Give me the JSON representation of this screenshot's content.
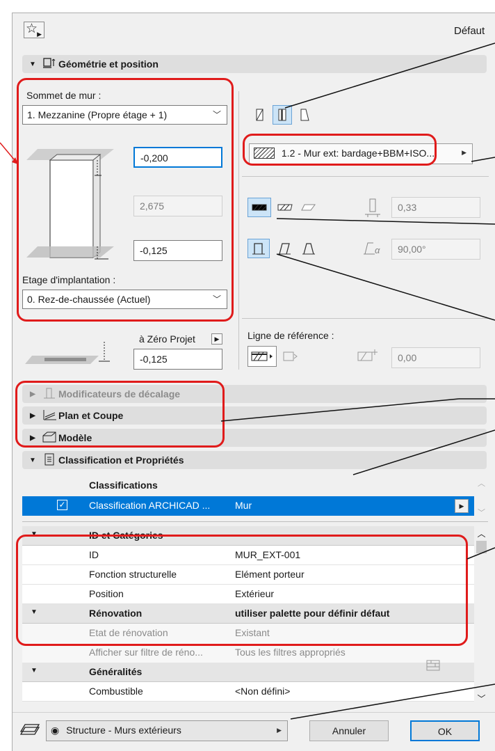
{
  "header": {
    "favorites_glyph": "☆",
    "default_label": "Défaut"
  },
  "geometry": {
    "section_title": "Géométrie et position",
    "top_label": "Sommet de mur :",
    "top_value": "1. Mezzanine (Propre étage + 1)",
    "top_offset": "-0,200",
    "height": "2,675",
    "base_offset": "-0,125",
    "home_story_label": "Etage d'implantation :",
    "home_story_value": "0. Rez-de-chaussée (Actuel)",
    "project_zero_label": "à Zéro Projet",
    "project_zero_value": "-0,125",
    "composite_name": "1.2 - Mur ext: bardage+BBM+ISO...",
    "thickness": "0,33",
    "angle": "90,00°",
    "angle_symbol": "α",
    "ref_line_label": "Ligne de référence :",
    "ref_offset": "0,00"
  },
  "sections": {
    "offset_modifiers": "Modificateurs de décalage",
    "floor_plan": "Plan et Coupe",
    "model": "Modèle",
    "classification": "Classification et Propriétés"
  },
  "classification": {
    "header": "Classifications",
    "item_name": "Classification ARCHICAD ...",
    "item_value": "Mur"
  },
  "properties": [
    {
      "kind": "group",
      "name": "ID et Catégories",
      "value": ""
    },
    {
      "kind": "row",
      "name": "ID",
      "value": "MUR_EXT-001"
    },
    {
      "kind": "row",
      "name": "Fonction structurelle",
      "value": "Elément porteur"
    },
    {
      "kind": "row",
      "name": "Position",
      "value": "Extérieur"
    },
    {
      "kind": "group",
      "name": "Rénovation",
      "value": "utiliser palette pour définir défaut"
    },
    {
      "kind": "grey",
      "name": "Etat de rénovation",
      "value": "Existant"
    },
    {
      "kind": "grey",
      "name": "Afficher sur filtre de réno...",
      "value": "Tous les filtres appropriés"
    },
    {
      "kind": "group",
      "name": "Généralités",
      "value": ""
    },
    {
      "kind": "row",
      "name": "Combustible",
      "value": "<Non défini>"
    }
  ],
  "footer": {
    "layer": "Structure - Murs extérieurs",
    "cancel": "Annuler",
    "ok": "OK"
  },
  "colors": {
    "annotation_red": "#e01b1b",
    "selection_blue": "#0078d7"
  }
}
